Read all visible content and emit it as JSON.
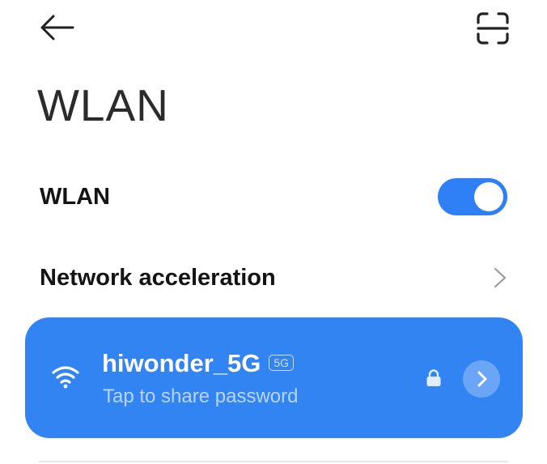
{
  "header": {
    "back_icon": "arrow-left-icon",
    "scan_icon": "qr-scan-icon"
  },
  "page_title": "WLAN",
  "settings": {
    "wlan_label": "WLAN",
    "wlan_enabled": true,
    "acceleration_label": "Network acceleration"
  },
  "connected_network": {
    "ssid": "hiwonder_5G",
    "band": "5G",
    "subtitle": "Tap to share password",
    "secured": true,
    "wifi_icon": "wifi-signal-icon",
    "lock_icon": "lock-icon",
    "detail_icon": "chevron-right-icon"
  },
  "colors": {
    "accent": "#2f80f6",
    "card": "#3384f3",
    "text": "#141414"
  }
}
